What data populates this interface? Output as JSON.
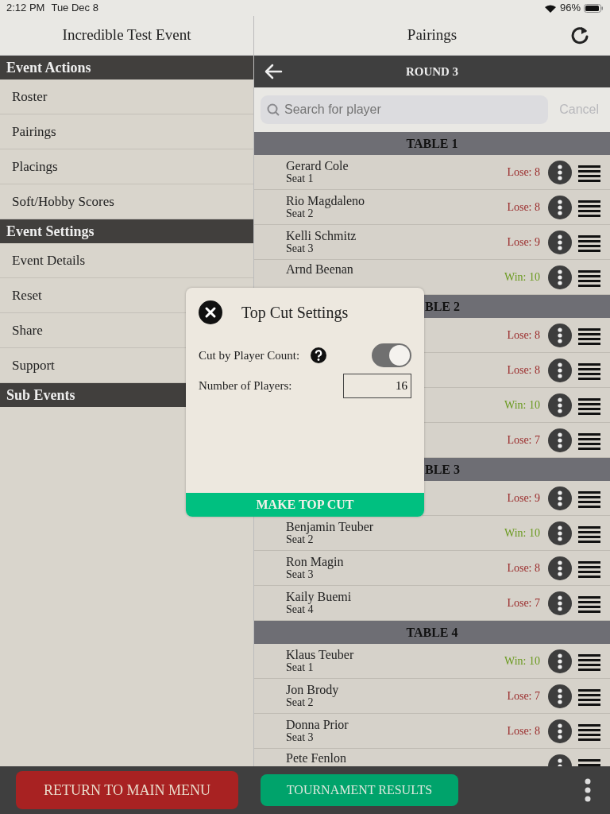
{
  "status_bar": {
    "time": "2:12 PM",
    "date": "Tue Dec 8",
    "battery": "96%"
  },
  "left_pane": {
    "title": "Incredible Test Event",
    "sections": [
      {
        "title": "Event Actions",
        "items": [
          "Roster",
          "Pairings",
          "Placings",
          "Soft/Hobby Scores"
        ]
      },
      {
        "title": "Event Settings",
        "items": [
          "Event Details",
          "Reset",
          "Share",
          "Support"
        ]
      },
      {
        "title": "Sub Events"
      }
    ]
  },
  "right_pane": {
    "title": "Pairings",
    "round": "ROUND 3",
    "search": {
      "placeholder": "Search for player",
      "cancel": "Cancel"
    },
    "tables": [
      {
        "title": "TABLE 1",
        "covered": false,
        "players": [
          {
            "name": "Gerard Cole",
            "seat": "Seat 1",
            "result": "Lose: 8",
            "kind": "lose"
          },
          {
            "name": "Rio Magdaleno",
            "seat": "Seat 2",
            "result": "Lose: 8",
            "kind": "lose"
          },
          {
            "name": "Kelli Schmitz",
            "seat": "Seat 3",
            "result": "Lose: 9",
            "kind": "lose"
          },
          {
            "name": "Arnd Beenan",
            "result": "Win: 10",
            "kind": "win"
          }
        ]
      },
      {
        "title": "BLE 2",
        "covered": true,
        "players": [
          {
            "result": "Lose: 8",
            "kind": "lose"
          },
          {
            "result": "Lose: 8",
            "kind": "lose"
          },
          {
            "result": "Win: 10",
            "kind": "win"
          },
          {
            "result": "Lose: 7",
            "kind": "lose"
          }
        ]
      },
      {
        "title": "BLE 3",
        "covered": true,
        "players": [
          {
            "result": "Lose: 9",
            "kind": "lose"
          },
          {
            "name": "Benjamin Teuber",
            "seat": "Seat 2",
            "result": "Win: 10",
            "kind": "win"
          },
          {
            "name": "Ron Magin",
            "seat": "Seat 3",
            "result": "Lose: 8",
            "kind": "lose"
          },
          {
            "name": "Kaily Buemi",
            "seat": "Seat 4",
            "result": "Lose: 7",
            "kind": "lose"
          }
        ]
      },
      {
        "title": "TABLE 4",
        "covered": false,
        "players": [
          {
            "name": "Klaus Teuber",
            "seat": "Seat 1",
            "result": "Win: 10",
            "kind": "win"
          },
          {
            "name": "Jon Brody",
            "seat": "Seat 2",
            "result": "Lose: 7",
            "kind": "lose"
          },
          {
            "name": "Donna Prior",
            "seat": "Seat 3",
            "result": "Lose: 8",
            "kind": "lose"
          },
          {
            "name": "Pete Fenlon"
          }
        ]
      }
    ]
  },
  "dialog": {
    "title": "Top Cut Settings",
    "settings": [
      {
        "kind": "toggle",
        "label": "Cut by Player Count:",
        "help": true,
        "on": true
      },
      {
        "kind": "number",
        "label": "Number of Players:",
        "value": "16"
      }
    ],
    "action": "MAKE TOP CUT"
  },
  "footer": {
    "left_button": "RETURN TO MAIN MENU",
    "right_button": "TOURNAMENT RESULTS"
  }
}
